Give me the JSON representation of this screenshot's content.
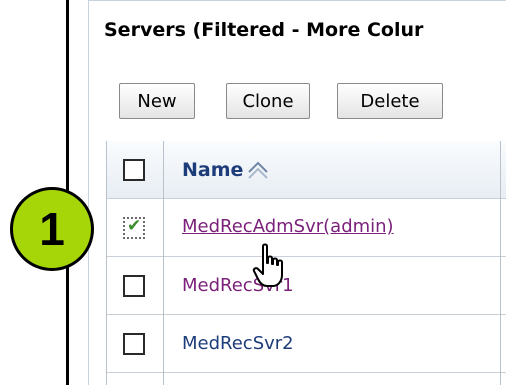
{
  "panel": {
    "title": "Servers (Filtered - More Colur"
  },
  "toolbar": {
    "new_label": "New",
    "clone_label": "Clone",
    "delete_label": "Delete"
  },
  "table": {
    "header": {
      "name": "Name",
      "sort_icon": "sort-ascending-icon"
    },
    "rows": [
      {
        "name": "MedRecAdmSvr(admin)",
        "checked": true
      },
      {
        "name": "MedRecSvr1",
        "checked": false
      },
      {
        "name": "MedRecSvr2",
        "checked": false
      }
    ]
  },
  "callout": {
    "number": "1",
    "color": "#a6d608"
  }
}
